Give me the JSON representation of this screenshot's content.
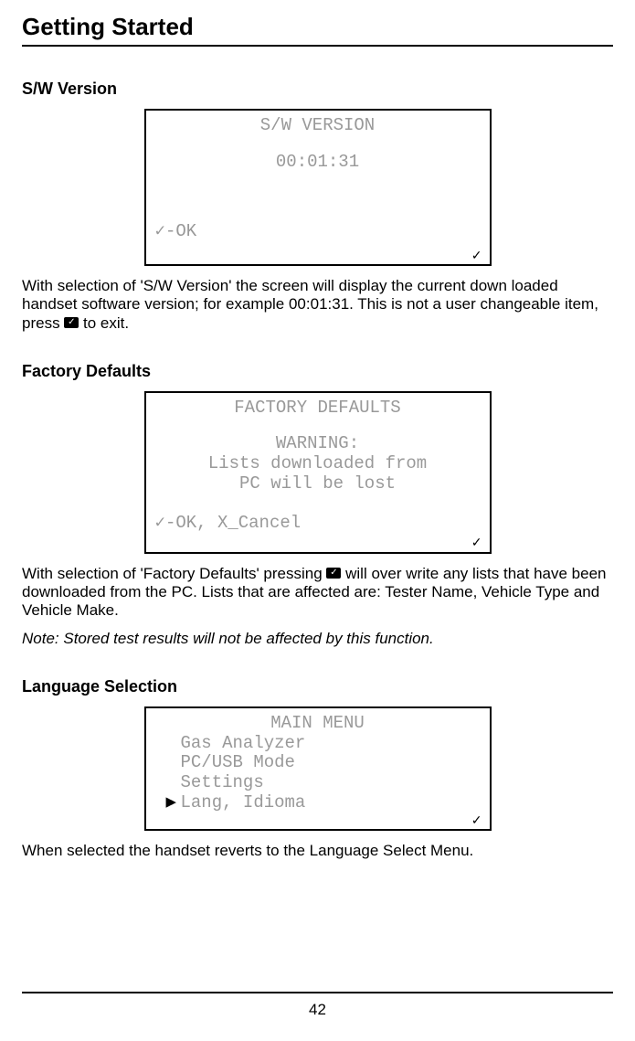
{
  "header": {
    "title": "Getting Started"
  },
  "sections": {
    "sw": {
      "heading": "S/W Version",
      "lcd": {
        "title": "S/W VERSION",
        "value": "00:01:31",
        "prompt": "✓-OK"
      },
      "body_pre": "With selection of 'S/W Version' the screen will display the current down loaded handset software version; for example 00:01:31. This is not a user changeable item, press ",
      "body_post": " to exit."
    },
    "fd": {
      "heading": "Factory Defaults",
      "lcd": {
        "title": "FACTORY DEFAULTS",
        "warn_label": "WARNING:",
        "warn_line1": "Lists downloaded from",
        "warn_line2": "PC will be lost",
        "prompt": "✓-OK, X_Cancel"
      },
      "body_pre": "With selection of 'Factory Defaults' pressing ",
      "body_post": " will over write any lists that have been downloaded from the PC. Lists that are affected are: Tester Name, Vehicle Type and Vehicle Make.",
      "note": "Note: Stored test results will not be affected by this function."
    },
    "lang": {
      "heading": "Language Selection",
      "lcd": {
        "title": "MAIN MENU",
        "items": {
          "0": "Gas Analyzer",
          "1": "PC/USB Mode",
          "2": "Settings",
          "3": "Lang, Idioma"
        }
      },
      "body": "When selected the handset reverts to the Language Select Menu."
    }
  },
  "page_number": "42"
}
